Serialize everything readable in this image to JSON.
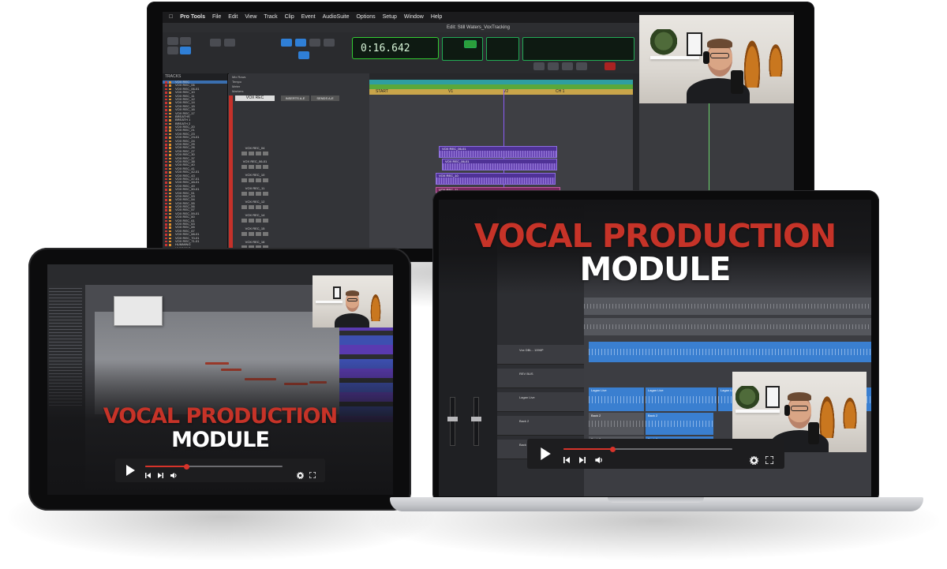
{
  "overlay": {
    "title_red": "VOCAL PRODUCTION",
    "title_white": "MODULE"
  },
  "monitor": {
    "menu": [
      "Pro Tools",
      "File",
      "Edit",
      "View",
      "Track",
      "Clip",
      "Event",
      "AudioSuite",
      "Options",
      "Setup",
      "Window",
      "Help"
    ],
    "window_title": "Edit: Still Waters_VoxTracking",
    "counter": "0:16.642",
    "tracks_header": "TRACKS",
    "track_list": [
      "VOX REC",
      "VOX REC_06",
      "VOX REC_06-01",
      "VOX REC_10",
      "VOX REC_11",
      "VOX REC_12",
      "VOX REC_14",
      "VOX REC_15",
      "VOX REC_16",
      "VOX REC_17",
      "BREATHS",
      "BREATH 1",
      "BREATH 2",
      "VOX REC_20",
      "VOX REC_21",
      "VOX REC_23",
      "VOX REC_23-01",
      "VOX REC_24",
      "VOX REC_25",
      "VOX REC_26",
      "VOX REC_27",
      "VOX REC_30",
      "VOX REC_37",
      "VOX REC_38",
      "VOX REC_40",
      "VOX REC_41",
      "VOX REC_42-01",
      "VOX REC_43",
      "VOX REC_47-01",
      "VOX REC_48-01",
      "VOX REC_49",
      "VOX REC_50-01",
      "VOX REC_51",
      "VOX REC_53",
      "VOX REC_54",
      "VOX REC_55",
      "VOX REC_56",
      "VOX REC_57",
      "VOX REC_59-01",
      "VOX REC_60",
      "VOX REC_61",
      "VOX REC_63",
      "VOX REC_65",
      "VOX REC_67",
      "VOX REC_68-01",
      "VOX REC_70-01",
      "VOX REC_71-01",
      "HUMMING",
      "HUMMING",
      "HUMMING",
      "HUMMING",
      "LOW OCTAVE",
      "LOW OCTAVE VOX",
      "BACK 02"
    ],
    "mix_track": "VOX REC",
    "mix_sections": [
      "INSERTS A-E",
      "SENDS A-E"
    ],
    "mix_tracks": [
      "VOX REC_04",
      "VOX REC_06-01",
      "VOX REC_10",
      "VOX REC_11",
      "VOX REC_12",
      "VOX REC_14",
      "VOX REC_15",
      "VOX REC_16"
    ],
    "mini_labels": [
      "Mix Rows",
      "Tempo",
      "Meter",
      "Markers"
    ],
    "marker_labels": [
      "START",
      "V1",
      "V2",
      "CH 1"
    ],
    "clips": [
      "VOX REC_06-01",
      "VOX REC_06-01",
      "VOX REC_10",
      "VOX REC_11"
    ]
  },
  "laptop": {
    "tracks": [
      "Vox DBL - 1096P",
      "REV BUS",
      "Lagan Live",
      "Back 2",
      "Back 3"
    ],
    "clip_labels": [
      "Lagan Live",
      "Lagan Live",
      "Lagan Live",
      "Back 2",
      "Back 2",
      "Back 2",
      "Back 2"
    ],
    "progress": 0.29
  },
  "tablet": {
    "progress": 0.3
  },
  "icons": [
    "play-icon",
    "skip-back-icon",
    "skip-forward-icon",
    "volume-icon",
    "gear-icon",
    "fullscreen-icon"
  ],
  "colors": {
    "accent_red": "#c63328",
    "progress_red": "#d7332a",
    "clip_purple": "#6a48b5",
    "clip_blue": "#3a7fd0"
  }
}
